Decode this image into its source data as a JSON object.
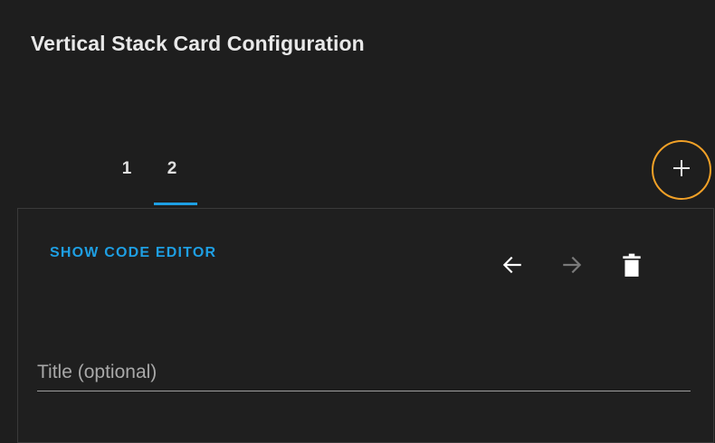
{
  "dialog": {
    "title": "Vertical Stack Card Configuration"
  },
  "tabs": [
    {
      "label": "1",
      "active": false
    },
    {
      "label": "2",
      "active": true
    }
  ],
  "add_button": {
    "icon": "plus-icon",
    "highlight_color": "#f2a127"
  },
  "card_editor": {
    "code_editor_label": "SHOW CODE EDITOR",
    "move_left_icon": "arrow-left-icon",
    "move_right_icon": "arrow-right-icon",
    "delete_icon": "trash-icon",
    "title_field": {
      "placeholder": "Title (optional)",
      "value": ""
    }
  },
  "colors": {
    "background": "#1e1e1e",
    "accent": "#1e9fe3",
    "text": "#e1e1e1"
  }
}
